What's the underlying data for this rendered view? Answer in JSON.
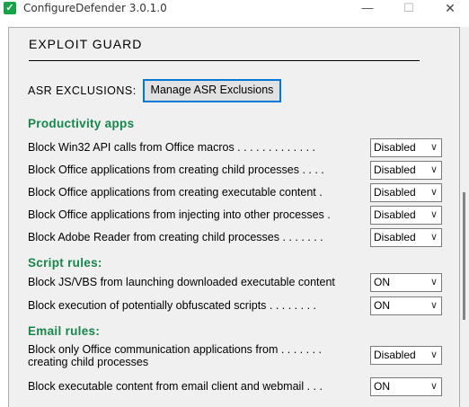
{
  "window": {
    "title": "ConfigureDefender 3.0.1.0",
    "app_icon": "shield-check-icon",
    "controls": {
      "minimize": "—",
      "maximize": "☐",
      "close": "✕"
    }
  },
  "section": {
    "title": "EXPLOIT  GUARD"
  },
  "asr": {
    "label": "ASR  EXCLUSIONS:",
    "button_label": "Manage ASR Exclusions"
  },
  "colors": {
    "group_title": "#15874a",
    "button_focus": "#0078d7"
  },
  "groups": [
    {
      "title": "Productivity apps",
      "rules": [
        {
          "label": "Block Win32 API calls from Office macros . . . . . . . . . . . . .",
          "value": "Disabled"
        },
        {
          "label": "Block Office applications from creating child processes . . . .",
          "value": "Disabled"
        },
        {
          "label": "Block Office applications from creating executable content .",
          "value": "Disabled"
        },
        {
          "label": "Block Office applications from injecting into other processes .",
          "value": "Disabled"
        },
        {
          "label": "Block Adobe Reader from creating child processes . . . . . . .",
          "value": "Disabled"
        }
      ]
    },
    {
      "title": "Script rules:",
      "rules": [
        {
          "label": "Block JS/VBS from launching downloaded executable content",
          "value": "ON"
        },
        {
          "label": "Block execution of potentially obfuscated scripts . . . . . . . .",
          "value": "ON"
        }
      ]
    },
    {
      "title": "Email rules:",
      "rules": [
        {
          "label": "Block only Office communication applications from . . . . . . .\ncreating child processes",
          "value": "Disabled"
        },
        {
          "label": "Block executable content from email client and webmail . . .",
          "value": "ON"
        }
      ]
    }
  ]
}
